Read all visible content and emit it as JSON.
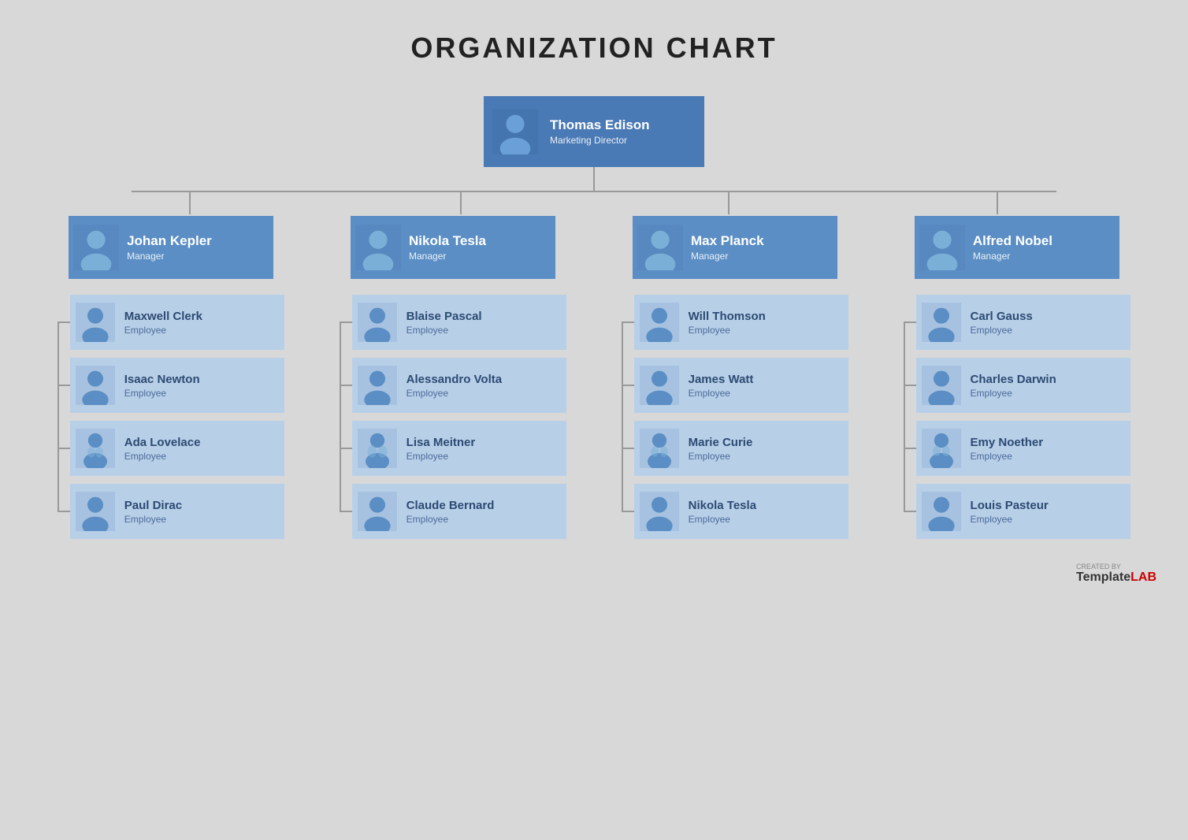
{
  "title": "ORGANIZATION CHART",
  "top_node": {
    "name": "Thomas Edison",
    "role": "Marketing Director"
  },
  "managers": [
    {
      "name": "Johan Kepler",
      "role": "Manager"
    },
    {
      "name": "Nikola Tesla",
      "role": "Manager"
    },
    {
      "name": "Max Planck",
      "role": "Manager"
    },
    {
      "name": "Alfred Nobel",
      "role": "Manager"
    }
  ],
  "employees": [
    [
      {
        "name": "Maxwell Clerk",
        "role": "Employee"
      },
      {
        "name": "Isaac Newton",
        "role": "Employee"
      },
      {
        "name": "Ada Lovelace",
        "role": "Employee"
      },
      {
        "name": "Paul Dirac",
        "role": "Employee"
      }
    ],
    [
      {
        "name": "Blaise Pascal",
        "role": "Employee"
      },
      {
        "name": "Alessandro Volta",
        "role": "Employee"
      },
      {
        "name": "Lisa Meitner",
        "role": "Employee"
      },
      {
        "name": "Claude Bernard",
        "role": "Employee"
      }
    ],
    [
      {
        "name": "Will Thomson",
        "role": "Employee"
      },
      {
        "name": "James Watt",
        "role": "Employee"
      },
      {
        "name": "Marie Curie",
        "role": "Employee"
      },
      {
        "name": "Nikola Tesla",
        "role": "Employee"
      }
    ],
    [
      {
        "name": "Carl Gauss",
        "role": "Employee"
      },
      {
        "name": "Charles Darwin",
        "role": "Employee"
      },
      {
        "name": "Emy Noether",
        "role": "Employee"
      },
      {
        "name": "Louis Pasteur",
        "role": "Employee"
      }
    ]
  ],
  "watermark": {
    "created_by": "CREATED BY",
    "brand_template": "Template",
    "brand_lab": "LAB"
  },
  "avatar": {
    "male": "male",
    "female": "female"
  },
  "colors": {
    "top_bg": "#4a7ab5",
    "manager_bg": "#5b8ec4",
    "employee_bg": "#b8cfe8",
    "connector": "#999999",
    "page_bg": "#d8d8d8"
  }
}
